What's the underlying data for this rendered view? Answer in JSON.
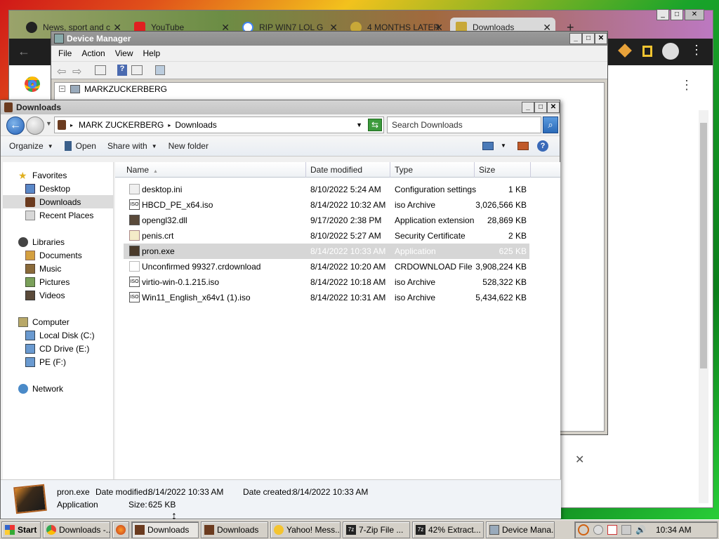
{
  "chrome": {
    "tabs": [
      {
        "title": "News, sport and c",
        "fav_color": "#222222"
      },
      {
        "title": "YouTube",
        "fav_color": "#e02020"
      },
      {
        "title": "RIP WIN7 LOL G",
        "fav_color": "#4285f4"
      },
      {
        "title": "4 MONTHS LATER",
        "fav_color": "#c8a838"
      },
      {
        "title": "Downloads",
        "fav_color": "#c8a838"
      }
    ],
    "new_tab": "+",
    "menu_icon": "⋮"
  },
  "device_manager": {
    "title": "Device Manager",
    "menu": [
      "File",
      "Action",
      "View",
      "Help"
    ],
    "tree_root": "MARKZUCKERBERG"
  },
  "explorer": {
    "title": "Downloads",
    "breadcrumb": [
      "MARK ZUCKERBERG",
      "Downloads"
    ],
    "search_placeholder": "Search Downloads",
    "commands": {
      "organize": "Organize",
      "open": "Open",
      "share": "Share with",
      "new_folder": "New folder"
    },
    "nav": {
      "favorites": "Favorites",
      "desktop": "Desktop",
      "downloads": "Downloads",
      "recent": "Recent Places",
      "libraries": "Libraries",
      "documents": "Documents",
      "music": "Music",
      "pictures": "Pictures",
      "videos": "Videos",
      "computer": "Computer",
      "local_disk": "Local Disk (C:)",
      "cd_drive": "CD Drive (E:)",
      "pe": "PE (F:)",
      "network": "Network"
    },
    "columns": {
      "name": "Name",
      "date": "Date modified",
      "type": "Type",
      "size": "Size"
    },
    "files": [
      {
        "name": "desktop.ini",
        "date": "8/10/2022 5:24 AM",
        "type": "Configuration settings",
        "size": "1 KB"
      },
      {
        "name": "HBCD_PE_x64.iso",
        "date": "8/14/2022 10:32 AM",
        "type": "iso Archive",
        "size": "3,026,566 KB"
      },
      {
        "name": "opengl32.dll",
        "date": "9/17/2020 2:38 PM",
        "type": "Application extension",
        "size": "28,869 KB"
      },
      {
        "name": "penis.crt",
        "date": "8/10/2022 5:27 AM",
        "type": "Security Certificate",
        "size": "2 KB"
      },
      {
        "name": "pron.exe",
        "date": "8/14/2022 10:33 AM",
        "type": "Application",
        "size": "625 KB"
      },
      {
        "name": "Unconfirmed 99327.crdownload",
        "date": "8/14/2022 10:20 AM",
        "type": "CRDOWNLOAD File",
        "size": "3,908,224 KB"
      },
      {
        "name": "virtio-win-0.1.215.iso",
        "date": "8/14/2022 10:18 AM",
        "type": "iso Archive",
        "size": "528,322 KB"
      },
      {
        "name": "Win11_English_x64v1 (1).iso",
        "date": "8/14/2022 10:31 AM",
        "type": "iso Archive",
        "size": "5,434,622 KB"
      }
    ],
    "details": {
      "name": "pron.exe",
      "modified_label": "Date modified:",
      "modified": "8/14/2022 10:33 AM",
      "created_label": "Date created:",
      "created": "8/14/2022 10:33 AM",
      "type": "Application",
      "size_label": "Size:",
      "size": "625 KB"
    }
  },
  "taskbar": {
    "start": "Start",
    "buttons": [
      "Downloads -...",
      "Downloads",
      "Downloads",
      "Yahoo! Mess...",
      "7-Zip File ...",
      "42% Extract...",
      "Device Mana..."
    ],
    "clock": "10:34 AM"
  }
}
